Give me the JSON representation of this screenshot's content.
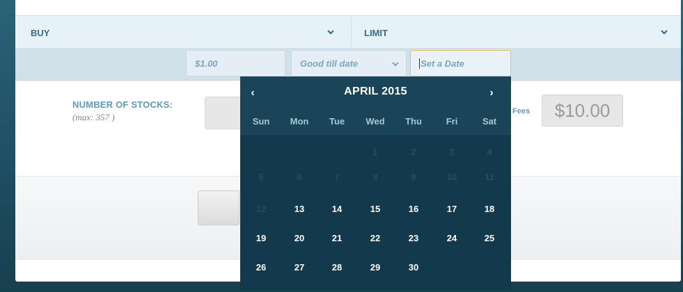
{
  "order": {
    "side_label": "BUY",
    "type_label": "LIMIT"
  },
  "params": {
    "price_value": "$1.00",
    "validity_value": "Good till date",
    "date_placeholder": "Set a Date"
  },
  "stocks": {
    "label": "NUMBER OF STOCKS:",
    "max_note": "(max: 357 )",
    "partial_value": "("
  },
  "fees": {
    "label": "Fees",
    "value": "$10.00"
  },
  "calendar": {
    "prev": "‹",
    "next": "›",
    "month_label": "APRIL 2015",
    "weekdays": [
      "Sun",
      "Mon",
      "Tue",
      "Wed",
      "Thu",
      "Fri",
      "Sat"
    ],
    "weeks": [
      [
        {
          "d": "",
          "on": false
        },
        {
          "d": "",
          "on": false
        },
        {
          "d": "",
          "on": false
        },
        {
          "d": "1",
          "on": false
        },
        {
          "d": "2",
          "on": false
        },
        {
          "d": "3",
          "on": false
        },
        {
          "d": "4",
          "on": false
        }
      ],
      [
        {
          "d": "5",
          "on": false
        },
        {
          "d": "6",
          "on": false
        },
        {
          "d": "7",
          "on": false
        },
        {
          "d": "8",
          "on": false
        },
        {
          "d": "9",
          "on": false
        },
        {
          "d": "10",
          "on": false
        },
        {
          "d": "11",
          "on": false
        }
      ],
      [
        {
          "d": "12",
          "on": false
        },
        {
          "d": "13",
          "on": true
        },
        {
          "d": "14",
          "on": true
        },
        {
          "d": "15",
          "on": true
        },
        {
          "d": "16",
          "on": true
        },
        {
          "d": "17",
          "on": true
        },
        {
          "d": "18",
          "on": true
        }
      ],
      [
        {
          "d": "19",
          "on": true
        },
        {
          "d": "20",
          "on": true
        },
        {
          "d": "21",
          "on": true
        },
        {
          "d": "22",
          "on": true
        },
        {
          "d": "23",
          "on": true
        },
        {
          "d": "24",
          "on": true
        },
        {
          "d": "25",
          "on": true
        }
      ],
      [
        {
          "d": "26",
          "on": true
        },
        {
          "d": "27",
          "on": true
        },
        {
          "d": "28",
          "on": true
        },
        {
          "d": "29",
          "on": true
        },
        {
          "d": "30",
          "on": true
        },
        {
          "d": "",
          "on": false
        },
        {
          "d": "",
          "on": false
        }
      ]
    ]
  },
  "colors": {
    "accent": "#2f6f8f",
    "calendar_bg": "#123a4c",
    "focus_border": "#e6c16b"
  }
}
